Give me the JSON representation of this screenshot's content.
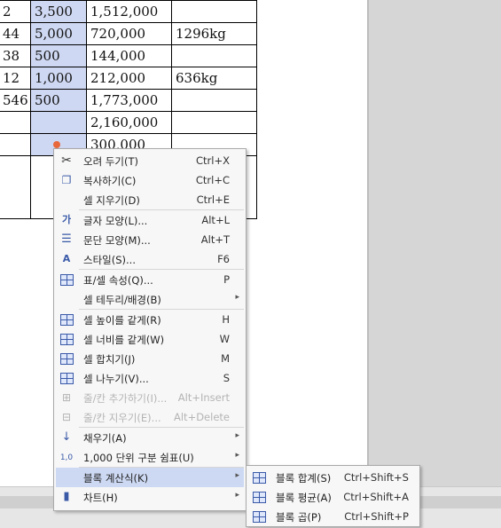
{
  "table": {
    "rows": [
      {
        "c0": "2",
        "c1": "3,500",
        "c2": "1,512,000",
        "c3": "",
        "sel": true
      },
      {
        "c0": "44",
        "c1": "5,000",
        "c2": "720,000",
        "c3": "1296kg",
        "sel": true
      },
      {
        "c0": "38",
        "c1": "500",
        "c2": "144,000",
        "c3": "",
        "sel": true
      },
      {
        "c0": "12",
        "c1": "1,000",
        "c2": "212,000",
        "c3": "636kg",
        "sel": true
      },
      {
        "c0": "546",
        "c1": "500",
        "c2": "1,773,000",
        "c3": "",
        "sel": true
      },
      {
        "c0": "",
        "c1": "",
        "c2": "2,160,000",
        "c3": "",
        "sel": true
      },
      {
        "c0": "",
        "c1": "",
        "c2": "300,000",
        "c3": "",
        "sel": true
      },
      {
        "c0": "",
        "c1": "",
        "c2": "",
        "c3": "",
        "sel": false
      }
    ]
  },
  "menu": {
    "items": [
      {
        "label": "오려 두기(T)",
        "shortcut": "Ctrl+X",
        "icon": "scissors-icon",
        "enabled": true
      },
      {
        "label": "복사하기(C)",
        "shortcut": "Ctrl+C",
        "icon": "copy-icon",
        "enabled": true
      },
      {
        "label": "셀 지우기(D)",
        "shortcut": "Ctrl+E",
        "icon": "",
        "enabled": true
      },
      {
        "label": "글자 모양(L)...",
        "shortcut": "Alt+L",
        "icon": "font-shape-icon",
        "enabled": true
      },
      {
        "label": "문단 모양(M)...",
        "shortcut": "Alt+T",
        "icon": "paragraph-icon",
        "enabled": true
      },
      {
        "label": "스타일(S)...",
        "shortcut": "F6",
        "icon": "style-icon",
        "enabled": true
      },
      {
        "label": "표/셀 속성(Q)...",
        "shortcut": "P",
        "icon": "table-properties-icon",
        "enabled": true
      },
      {
        "label": "셀 테두리/배경(B)",
        "shortcut": "",
        "icon": "",
        "enabled": true,
        "submenu": true
      },
      {
        "label": "셀 높이를 같게(R)",
        "shortcut": "H",
        "icon": "equal-height-icon",
        "enabled": true
      },
      {
        "label": "셀 너비를 같게(W)",
        "shortcut": "W",
        "icon": "equal-width-icon",
        "enabled": true
      },
      {
        "label": "셀 합치기(J)",
        "shortcut": "M",
        "icon": "merge-cells-icon",
        "enabled": true
      },
      {
        "label": "셀 나누기(V)...",
        "shortcut": "S",
        "icon": "split-cells-icon",
        "enabled": true
      },
      {
        "label": "줄/칸 추가하기(I)...",
        "shortcut": "Alt+Insert",
        "icon": "insert-row-icon",
        "enabled": false
      },
      {
        "label": "줄/칸 지우기(E)...",
        "shortcut": "Alt+Delete",
        "icon": "delete-row-icon",
        "enabled": false
      },
      {
        "label": "채우기(A)",
        "shortcut": "",
        "icon": "fill-icon",
        "enabled": true,
        "submenu": true
      },
      {
        "label": "1,000 단위 구분 쉼표(U)",
        "shortcut": "",
        "icon": "thousands-comma-icon",
        "enabled": true,
        "submenu": true
      },
      {
        "label": "블록 계산식(K)",
        "shortcut": "",
        "icon": "",
        "enabled": true,
        "submenu": true,
        "highlighted": true
      },
      {
        "label": "차트(H)",
        "shortcut": "",
        "icon": "chart-icon",
        "enabled": true,
        "submenu": true
      }
    ],
    "submenu_arrow": "▸"
  },
  "submenu": {
    "items": [
      {
        "label": "블록 합계(S)",
        "shortcut": "Ctrl+Shift+S",
        "icon": "block-sum-icon"
      },
      {
        "label": "블록 평균(A)",
        "shortcut": "Ctrl+Shift+A",
        "icon": "block-average-icon"
      },
      {
        "label": "블록 곱(P)",
        "shortcut": "Ctrl+Shift+P",
        "icon": "block-product-icon"
      }
    ]
  },
  "colors": {
    "selection": "#cfd8f2",
    "highlight": "#cdd9f3",
    "cell_dot": "#e8683b"
  }
}
